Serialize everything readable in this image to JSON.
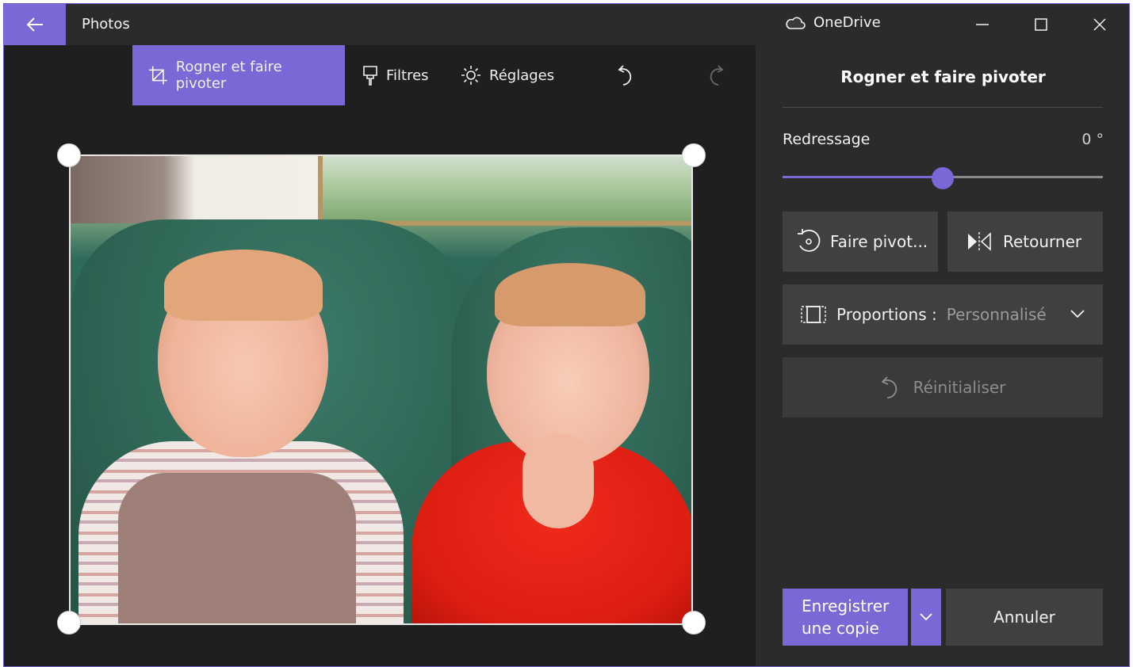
{
  "titlebar": {
    "app_title": "Photos",
    "onedrive_label": "OneDrive",
    "back_icon": "arrow-left-icon",
    "minimize_icon": "minimize-icon",
    "maximize_icon": "maximize-icon",
    "close_icon": "close-icon"
  },
  "toolbar": {
    "crop_label": "Rogner et faire pivoter",
    "filters_label": "Filtres",
    "adjust_label": "Réglages"
  },
  "panel": {
    "title": "Rogner et faire pivoter",
    "straighten_label": "Redressage",
    "straighten_value": "0 °",
    "straighten_level_fraction": 0.5,
    "rotate_label": "Faire pivot...",
    "flip_label": "Retourner",
    "aspect_label": "Proportions :",
    "aspect_value": "Personnalisé",
    "reset_label": "Réinitialiser",
    "save_line1": "Enregistrer",
    "save_line2": "une copie",
    "cancel_label": "Annuler"
  },
  "colors": {
    "accent": "#7b68d6",
    "panel_bg": "#2b2b2b",
    "canvas_bg": "#1f1f1f"
  }
}
